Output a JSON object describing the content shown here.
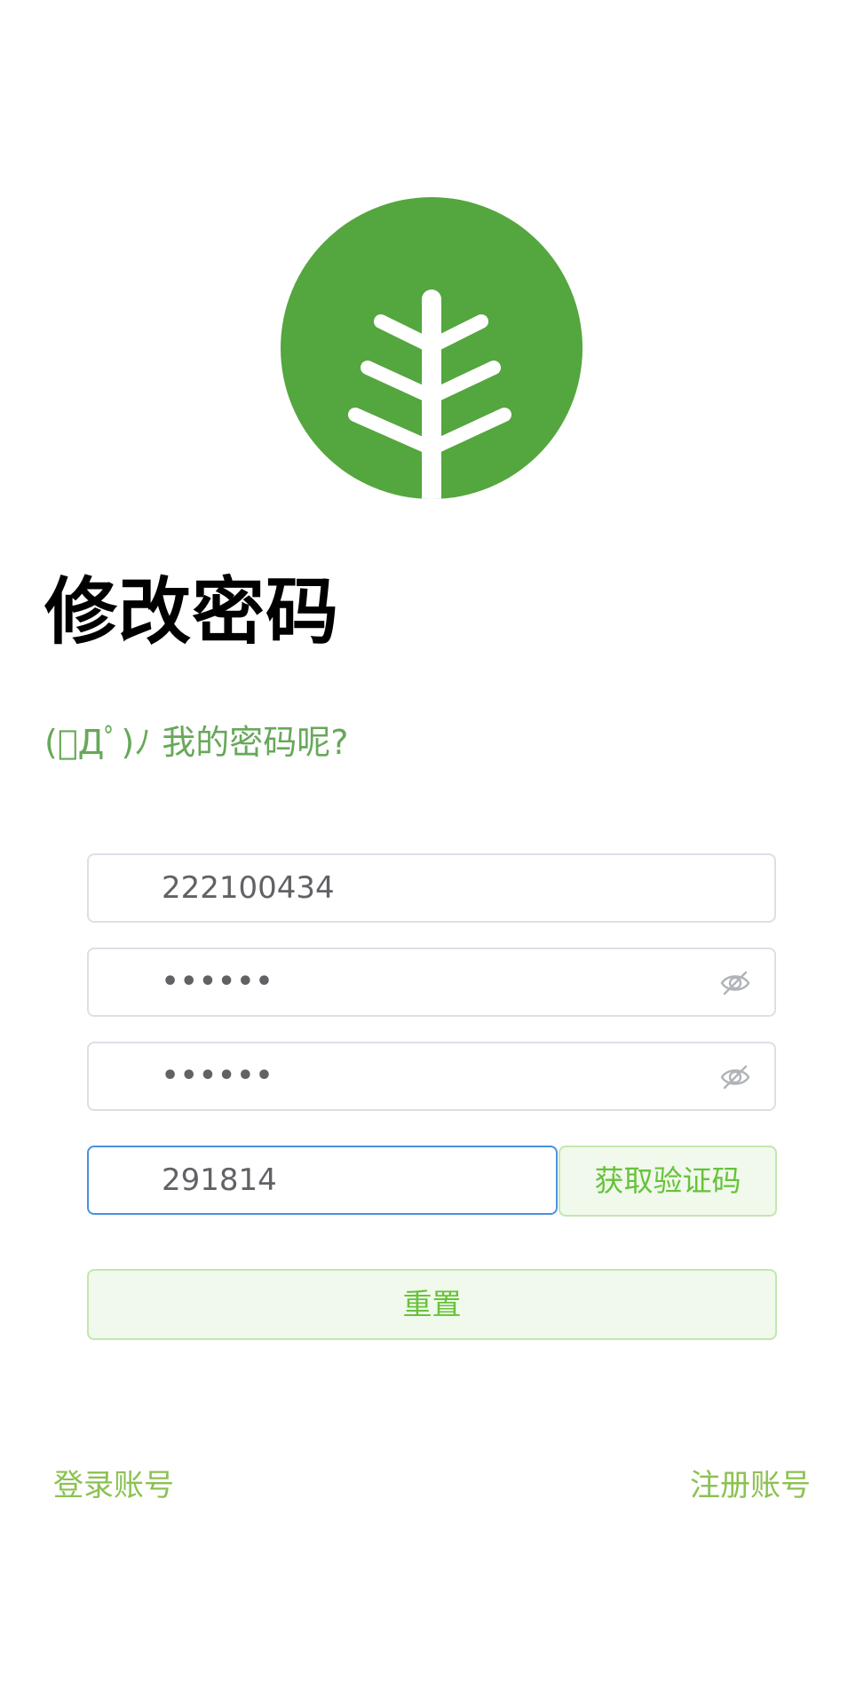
{
  "header": {
    "logo_icon": "tree-logo-icon",
    "title": "修改密码",
    "subtitle": "(ﾟДﾟ)ﾉ 我的密码呢?"
  },
  "form": {
    "account": {
      "value": "222100434"
    },
    "password": {
      "value": "••••••",
      "toggle_icon": "eye-off-icon"
    },
    "confirm_password": {
      "value": "••••••",
      "toggle_icon": "eye-off-icon"
    },
    "verification_code": {
      "value": "291814"
    },
    "get_code_label": "获取验证码",
    "reset_label": "重置"
  },
  "footer": {
    "login_link": "登录账号",
    "register_link": "注册账号"
  },
  "colors": {
    "brand_green": "#54a63f",
    "subtitle_green": "#67a85a",
    "button_text": "#67c23a",
    "button_bg": "#f0f9eb",
    "link_green": "#8cc152",
    "focus_blue": "#4a90e2"
  }
}
